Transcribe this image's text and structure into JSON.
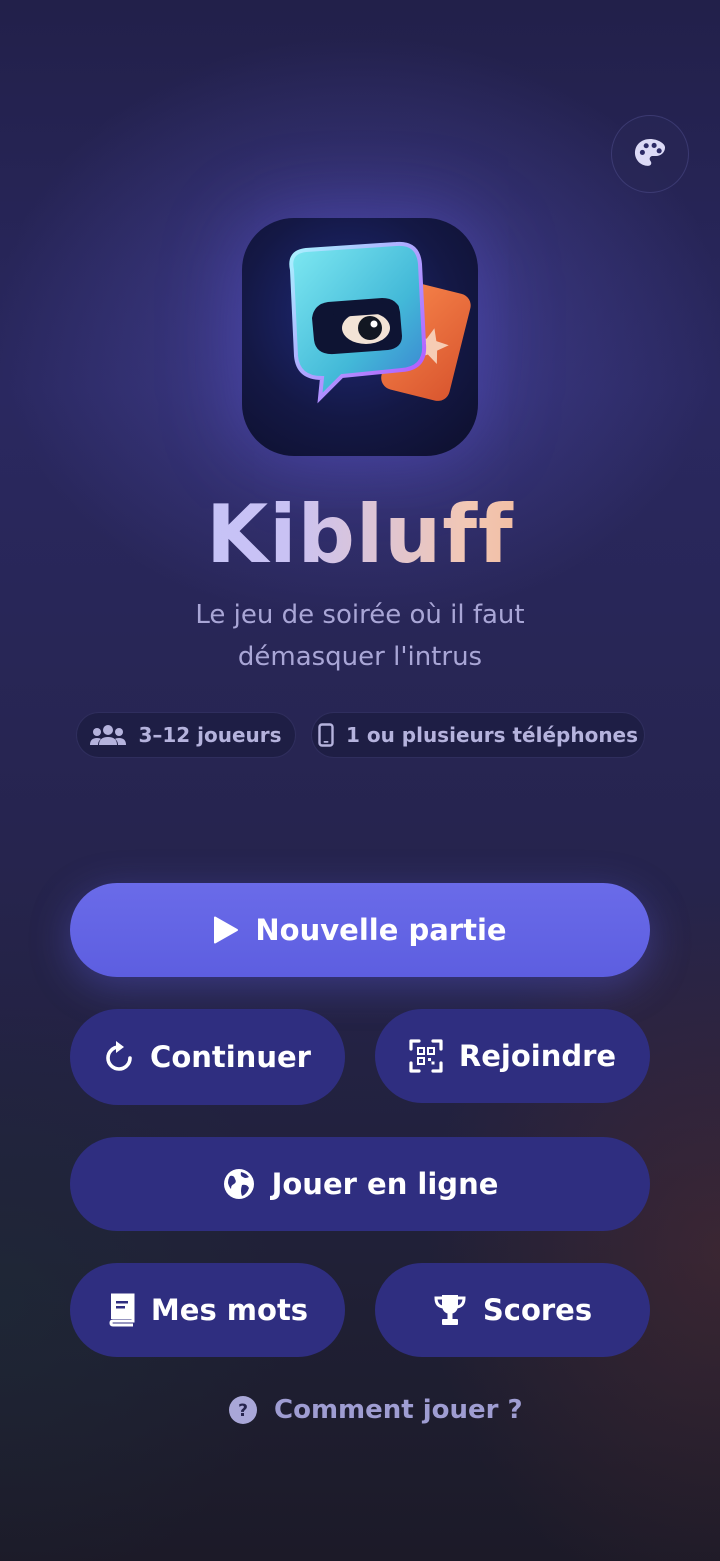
{
  "header": {
    "theme_button_icon": "palette-icon"
  },
  "app": {
    "icon": "app-logo-chat-bubble-eye",
    "name": "Kibluff",
    "tagline_line1": "Le jeu de soirée où il faut",
    "tagline_line2": "démasquer l'intrus"
  },
  "chips": {
    "players": {
      "icon": "group-icon",
      "label": "3–12 joueurs"
    },
    "devices": {
      "icon": "phone-icon",
      "label": "1 ou plusieurs téléphones"
    }
  },
  "actions": {
    "new_game": {
      "icon": "play-icon",
      "label": "Nouvelle partie"
    },
    "continue": {
      "icon": "refresh-icon",
      "label": "Continuer"
    },
    "join": {
      "icon": "qr-scan-icon",
      "label": "Rejoindre"
    },
    "online": {
      "icon": "globe-icon",
      "label": "Jouer en ligne"
    },
    "my_words": {
      "icon": "book-icon",
      "label": "Mes mots"
    },
    "scores": {
      "icon": "trophy-icon",
      "label": "Scores"
    }
  },
  "help": {
    "icon": "question-icon",
    "label": "Comment jouer ?"
  },
  "colors": {
    "primary": "#6364E4",
    "secondary_button": "#2F2E80",
    "title_gradient_start": "#BFC5FF",
    "title_gradient_end": "#F19A62"
  }
}
